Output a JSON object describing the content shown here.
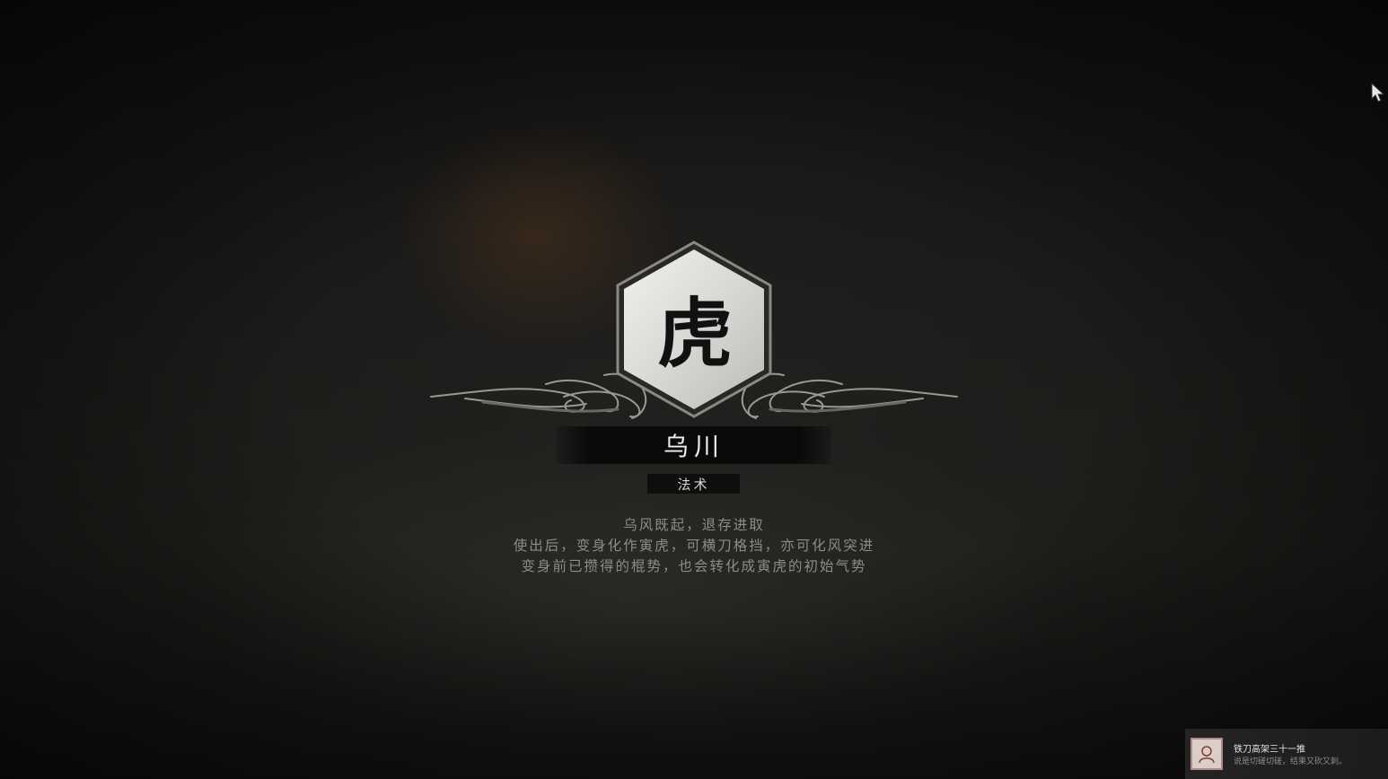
{
  "emblem": {
    "character": "虎",
    "icon": "tiger-emblem-icon"
  },
  "spell": {
    "name": "乌川",
    "type": "法术"
  },
  "description": [
    "乌风既起，退存进取",
    "使出后，变身化作寅虎，可横刀格挡，亦可化风突进",
    "变身前已攒得的棍势，也会转化成寅虎的初始气势"
  ],
  "notification": {
    "title": "铁刀高架三十一推",
    "subtitle": "说是切磋切磋，结果又砍又刺。",
    "icon": "character-portrait-icon"
  },
  "cursor": {
    "icon": "mouse-cursor-icon"
  },
  "colors": {
    "panel": "#0a0a0a",
    "text": "#eeeeec",
    "desc": "#8e8c88"
  }
}
